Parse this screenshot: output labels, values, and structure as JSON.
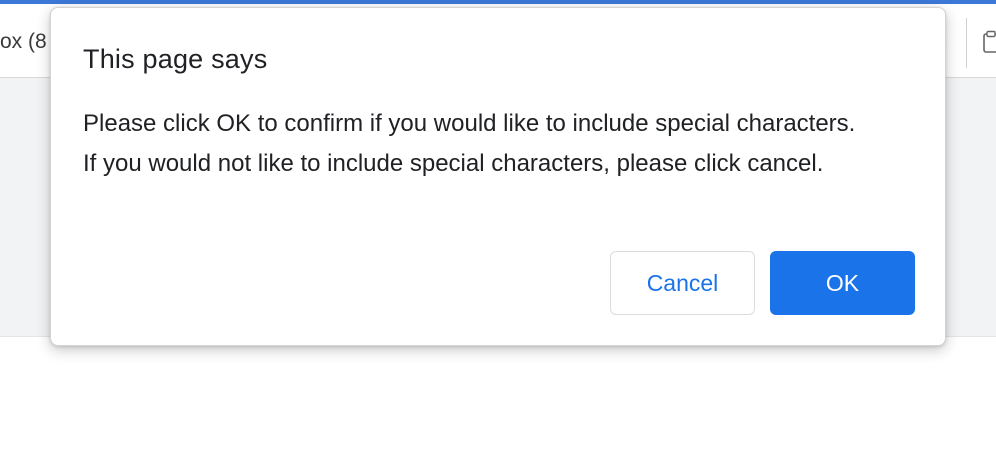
{
  "browser": {
    "tab_fragment": "ox (8",
    "close_glyph": "x",
    "clipboard_icon": "clipboard-icon"
  },
  "dialog": {
    "title": "This page says",
    "message": "Please click OK to confirm if you would like to include special characters. If you would not like to include special characters, please click cancel.",
    "cancel_label": "Cancel",
    "ok_label": "OK"
  },
  "colors": {
    "accent": "#1a73e8",
    "top_accent": "#3c78d8",
    "page_background": "#f1f3f5"
  }
}
